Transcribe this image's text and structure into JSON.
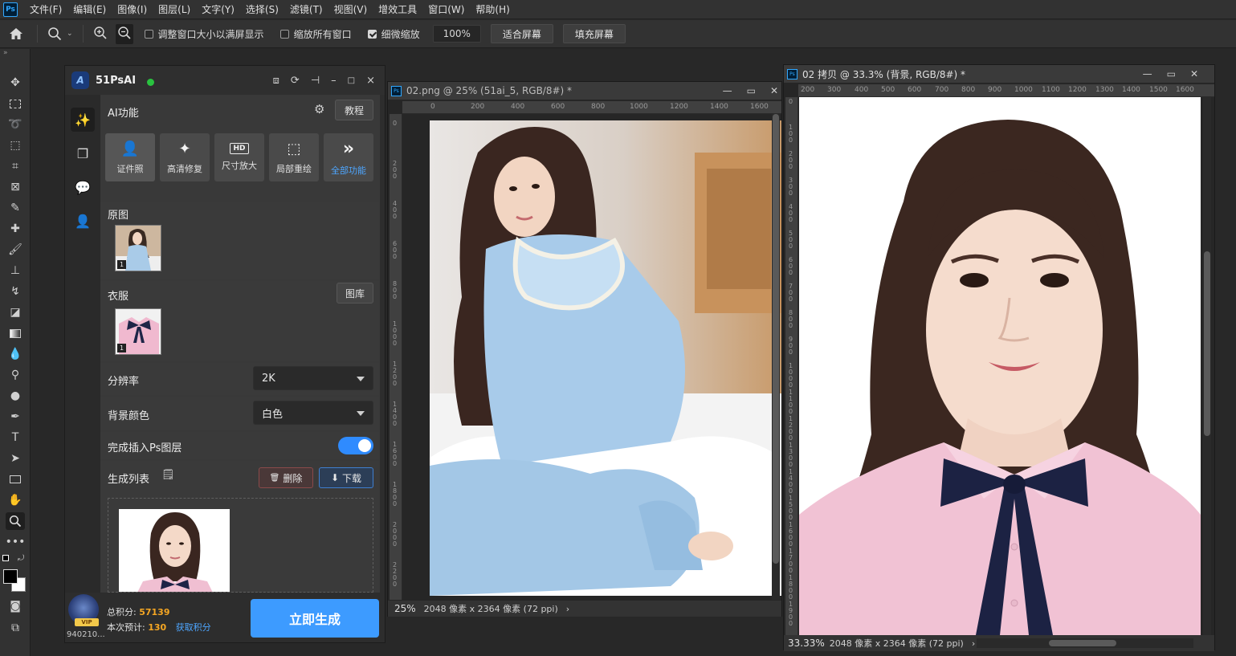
{
  "menu": [
    "文件(F)",
    "编辑(E)",
    "图像(I)",
    "图层(L)",
    "文字(Y)",
    "选择(S)",
    "滤镜(T)",
    "视图(V)",
    "增效工具",
    "窗口(W)",
    "帮助(H)"
  ],
  "ps_logo": "Ps",
  "options": {
    "resize_windows": "调整窗口大小以满屏显示",
    "zoom_all": "缩放所有窗口",
    "scrubby_zoom": "细微缩放",
    "zoom_value": "100%",
    "fit_screen": "适合屏幕",
    "fill_screen": "填充屏幕"
  },
  "plugin": {
    "logo": "A",
    "title": "51PsAI",
    "ai_section": "AI功能",
    "tutorial_btn": "教程",
    "functions": [
      {
        "label": "证件照",
        "icon": "id-photo-icon"
      },
      {
        "label": "高清修复",
        "icon": "sparkle-icon"
      },
      {
        "label": "尺寸放大",
        "icon": "hd-icon"
      },
      {
        "label": "局部重绘",
        "icon": "region-redraw-icon"
      },
      {
        "label": "全部功能",
        "icon": "double-chevron-icon"
      }
    ],
    "original_label": "原图",
    "original_badge": "1",
    "clothes_label": "衣服",
    "gallery_btn": "图库",
    "clothes_badge": "1",
    "resolution_label": "分辨率",
    "resolution_value": "2K",
    "bg_color_label": "背景颜色",
    "bg_color_value": "白色",
    "insert_layer_label": "完成插入Ps图层",
    "insert_layer_on": true,
    "gen_list_label": "生成列表",
    "delete_btn": "删除",
    "download_btn": "下载",
    "vip_badge": "VIP",
    "user_id": "940210...",
    "total_points_label": "总积分:",
    "total_points": "57139",
    "estimate_label": "本次预计:",
    "estimate": "130",
    "get_points": "获取积分",
    "generate_btn": "立即生成"
  },
  "doc1": {
    "ps": "Ps",
    "title": "02.png @ 25% (51ai_5, RGB/8#) *",
    "ruler": [
      "0",
      "200",
      "400",
      "600",
      "800",
      "1000",
      "1200",
      "1400",
      "1600"
    ],
    "ruler_v": [
      "0",
      "2 0 0",
      "4 0 0",
      "6 0 0",
      "8 0 0",
      "1 0 0 0",
      "1 2 0 0",
      "1 4 0 0",
      "1 6 0 0",
      "1 8 0 0",
      "2 0 0 0",
      "2 2 0 0"
    ],
    "zoom": "25%",
    "dims": "2048 像素 x 2364 像素 (72 ppi)"
  },
  "doc2": {
    "ps": "Ps",
    "title": "02 拷贝 @ 33.3% (背景, RGB/8#) *",
    "ruler": [
      "200",
      "300",
      "400",
      "500",
      "600",
      "700",
      "800",
      "900",
      "1000",
      "1100",
      "1200",
      "1300",
      "1400",
      "1500",
      "1600"
    ],
    "ruler_v": [
      "0",
      "1 0 0",
      "2 0 0",
      "3 0 0",
      "4 0 0",
      "5 0 0",
      "6 0 0",
      "7 0 0",
      "8 0 0",
      "9 0 0",
      "1 0 0 0",
      "1 1 0 0",
      "1 2 0 0",
      "1 3 0 0",
      "1 4 0 0",
      "1 5 0 0",
      "1 6 0 0",
      "1 7 0 0",
      "1 8 0 0",
      "1 9 0 0"
    ],
    "zoom": "33.33%",
    "dims": "2048 像素 x 2364 像素 (72 ppi)"
  },
  "colors": {
    "accent": "#3d9bff",
    "toggle": "#2f8bff",
    "points": "#f5a623"
  }
}
